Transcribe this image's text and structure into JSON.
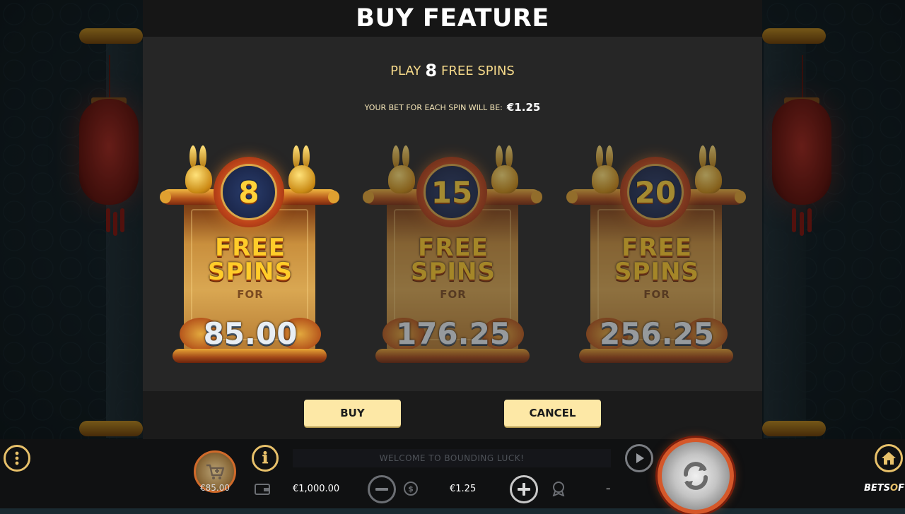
{
  "modal": {
    "title": "BUY FEATURE",
    "play_prefix": "PLAY",
    "play_count": "8",
    "play_suffix": "FREE SPINS",
    "bet_label": "YOUR BET FOR EACH SPIN WILL BE:",
    "bet_value": "€1.25",
    "buy_label": "BUY",
    "cancel_label": "CANCEL"
  },
  "options": [
    {
      "spins": "8",
      "title_line1": "FREE",
      "title_line2": "SPINS",
      "for_label": "FOR",
      "price": "85.00",
      "selected": true
    },
    {
      "spins": "15",
      "title_line1": "FREE",
      "title_line2": "SPINS",
      "for_label": "FOR",
      "price": "176.25",
      "selected": false
    },
    {
      "spins": "20",
      "title_line1": "FREE",
      "title_line2": "SPINS",
      "for_label": "FOR",
      "price": "256.25",
      "selected": false
    }
  ],
  "bottom_bar": {
    "welcome_message": "WELCOME TO BOUNDING LUCK!",
    "buy_feature_price": "€85.00",
    "balance": "€1,000.00",
    "bet": "€1.25",
    "win": "–",
    "brand_part1": "BETS",
    "brand_o": "O",
    "brand_part2": "FT"
  },
  "icons": {
    "menu": "menu-dots-icon",
    "info": "info-icon",
    "cart": "cart-icon",
    "wallet": "wallet-icon",
    "minus": "minus-icon",
    "coins": "coins-icon",
    "plus": "plus-icon",
    "trophy": "trophy-icon",
    "autoplay": "autoplay-icon",
    "spin": "spin-icon",
    "home": "home-icon"
  },
  "colors": {
    "accent_gold": "#e8c16a",
    "button_bg": "#fde8a6",
    "spin_ring": "#d5582a"
  }
}
